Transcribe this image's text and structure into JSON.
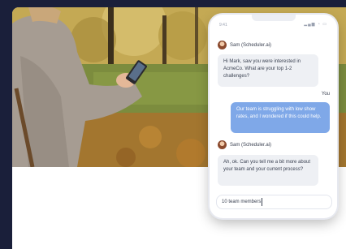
{
  "phone": {
    "status_time": "9:41",
    "status_icons": "▂▄▆ ◔ ▭"
  },
  "chat": {
    "messages": [
      {
        "sender": "Sam (Scheduler.ai)",
        "text": "Hi Mark, saw you were interested in AcmeCo. What are your top 1-2 challenges?"
      },
      {
        "sender": "You",
        "text": "Our team is struggling with low show rates, and I wondered if this could help."
      },
      {
        "sender": "Sam (Scheduler.ai)",
        "text": "Ah, ok. Can you tell me a bit more about your team and your current process?"
      }
    ],
    "input_value": "10 team members"
  },
  "colors": {
    "page_background": "#1a1f3a",
    "outgoing_bubble": "#7fa8e8",
    "incoming_bubble": "#eef0f4"
  }
}
